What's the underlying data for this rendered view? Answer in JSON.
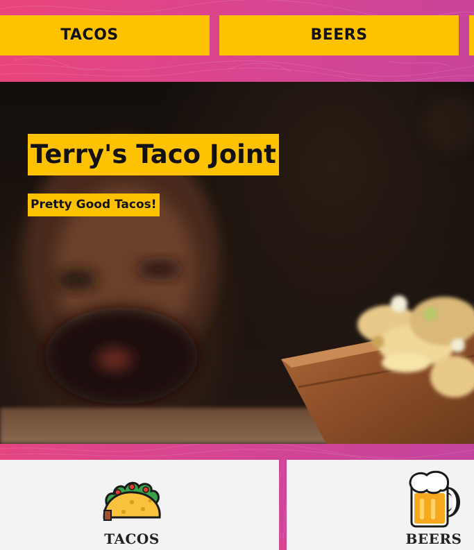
{
  "nav": {
    "items": [
      {
        "label": "TACOS"
      },
      {
        "label": "BEERS"
      },
      {
        "label": ""
      }
    ]
  },
  "hero": {
    "title": "Terry's Taco Joint",
    "subtitle": "Pretty Good Tacos!",
    "image_icon": "hero-photo-man-with-tacos"
  },
  "cards": [
    {
      "label": "TACOS",
      "icon": "taco-icon"
    },
    {
      "label": "BEERS",
      "icon": "beer-mug-icon"
    }
  ],
  "colors": {
    "accent": "#ffc200",
    "background_pink": "#e9457a",
    "background_magenta": "#c2449f",
    "card_background": "#f3f3f3"
  }
}
